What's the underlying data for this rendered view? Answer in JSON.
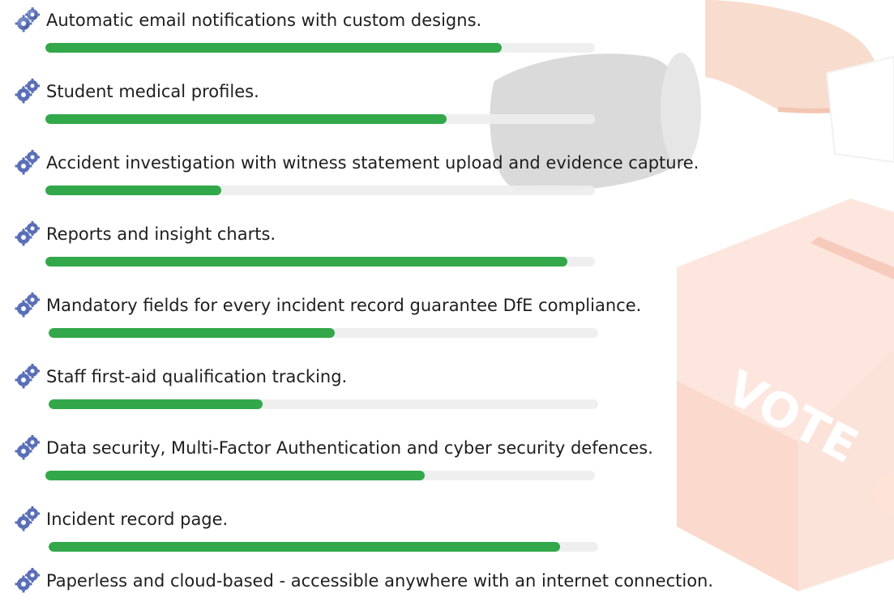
{
  "colors": {
    "fill": "#32a84a",
    "track": "#eeeeee",
    "text": "#1e1e1e",
    "ballot_box": "#fbe4dc",
    "sleeve": "#d8d8d8",
    "hand": "#f6d9ca"
  },
  "icons": {
    "item_bullet": "gear-icon"
  },
  "background": {
    "ballot_text": "VOTE"
  },
  "features": [
    {
      "label": "Automatic email notifications with custom designs.",
      "progress": 0.83
    },
    {
      "label": "Student medical profiles.",
      "progress": 0.73
    },
    {
      "label": "Accident investigation with witness statement upload and evidence capture.",
      "progress": 0.32
    },
    {
      "label": "Reports and insight charts.",
      "progress": 0.95
    },
    {
      "label": "Mandatory fields for every incident record guarantee DfE compliance.",
      "progress": 0.52
    },
    {
      "label": "Staff first-aid qualification tracking.",
      "progress": 0.39
    },
    {
      "label": "Data security, Multi-Factor Authentication and cyber security defences.",
      "progress": 0.69
    },
    {
      "label": "Incident record page.",
      "progress": 0.93
    },
    {
      "label": "Paperless and cloud-based - accessible anywhere with an internet connection.",
      "progress": null
    }
  ]
}
